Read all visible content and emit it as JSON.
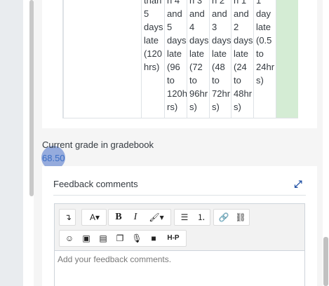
{
  "rubric": {
    "columns": [
      {
        "text": "than\n5\ndays\nlate\n(120\nhrs)",
        "selected": false
      },
      {
        "text": "n 4\nand\n5\ndays\nlate\n(96\nto\n120h\nrs)",
        "selected": false
      },
      {
        "text": "n 3\nand\n4\ndays\nlate\n(72\nto\n96hr\ns)",
        "selected": false
      },
      {
        "text": "n 2\nand\n3\ndays\nlate\n(48\nto\n72hr\ns)",
        "selected": false
      },
      {
        "text": "n 1\nand\n2\ndays\nlate\n(24\nto\n48hr\ns)",
        "selected": false
      },
      {
        "text": "1\nday\nlate\n(0.5\nto\n24hr\ns)",
        "selected": false
      },
      {
        "text": "",
        "selected": true
      }
    ]
  },
  "grade": {
    "label": "Current grade in gradebook",
    "value": "68.50"
  },
  "feedback": {
    "title": "Feedback comments",
    "expand_icon": "expand-icon",
    "placeholder": "Add your feedback comments."
  },
  "toolbar": {
    "row1": [
      {
        "name": "toolbar-toggle-button",
        "glyph": "↴"
      },
      {
        "name": "font-style-button",
        "glyph": "A▾"
      },
      {
        "name": "bold-button",
        "glyph": "B"
      },
      {
        "name": "italic-button",
        "glyph": "I"
      },
      {
        "name": "text-color-button",
        "glyph": "🖌▾"
      },
      {
        "name": "unordered-list-button",
        "glyph": "☰"
      },
      {
        "name": "ordered-list-button",
        "glyph": "⒈"
      },
      {
        "name": "link-button",
        "glyph": "🔗"
      },
      {
        "name": "unlink-button",
        "glyph": "⛓"
      }
    ],
    "row2": [
      {
        "name": "emoji-button",
        "glyph": "☺"
      },
      {
        "name": "image-button",
        "glyph": "▣"
      },
      {
        "name": "media-button",
        "glyph": "▤"
      },
      {
        "name": "manage-files-button",
        "glyph": "❐"
      },
      {
        "name": "record-audio-button",
        "glyph": "🎙"
      },
      {
        "name": "record-video-button",
        "glyph": "■"
      },
      {
        "name": "h5p-button",
        "glyph": "H-P"
      }
    ]
  }
}
